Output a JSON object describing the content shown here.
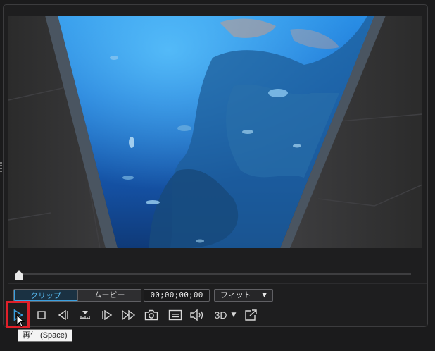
{
  "preview": {
    "mode_tabs": [
      {
        "label": "クリップ",
        "active": true
      },
      {
        "label": "ムービー",
        "active": false
      }
    ],
    "timecode": "00;00;00;00",
    "zoom": {
      "selected": "フィット"
    },
    "seek_position": 0
  },
  "toolbar": {
    "buttons": [
      {
        "name": "play-button",
        "icon": "play-icon"
      },
      {
        "name": "stop-button",
        "icon": "stop-icon"
      },
      {
        "name": "previous-frame-button",
        "icon": "previous-frame-icon"
      },
      {
        "name": "split-button",
        "icon": "split-icon"
      },
      {
        "name": "next-frame-button",
        "icon": "next-frame-icon"
      },
      {
        "name": "fast-forward-button",
        "icon": "fast-forward-icon"
      },
      {
        "name": "snapshot-button",
        "icon": "camera-icon"
      },
      {
        "name": "subtitle-button",
        "icon": "subtitle-icon"
      },
      {
        "name": "volume-button",
        "icon": "speaker-icon"
      },
      {
        "name": "3d-button",
        "icon": "3d-icon"
      },
      {
        "name": "undock-button",
        "icon": "external-window-icon"
      }
    ],
    "threeD_label": "3D"
  },
  "tooltip": {
    "text": "再生 (Space)"
  },
  "colors": {
    "accent": "#3aa0e0",
    "highlight": "#e0202a",
    "panel": "#1e1e1f"
  }
}
